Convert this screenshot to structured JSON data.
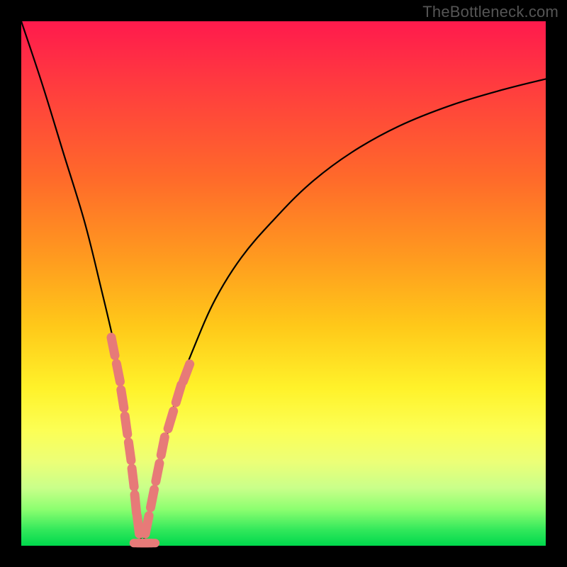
{
  "watermark": "TheBottleneck.com",
  "chart_data": {
    "type": "line",
    "title": "",
    "xlabel": "",
    "ylabel": "",
    "xlim": [
      0,
      100
    ],
    "ylim": [
      0,
      100
    ],
    "background_gradient": {
      "top_color": "#ff1a4d",
      "bottom_color": "#00d84c",
      "meaning": "red = high bottleneck %, green = 0% bottleneck"
    },
    "series": [
      {
        "name": "bottleneck-curve",
        "description": "V-shaped bottleneck percentage curve; minimum near x≈23 at y≈0",
        "x": [
          0,
          4,
          8,
          12,
          15,
          18,
          20,
          22,
          23,
          24,
          26,
          28,
          30,
          33,
          37,
          42,
          48,
          55,
          63,
          72,
          82,
          92,
          100
        ],
        "values": [
          100,
          88,
          75,
          62,
          50,
          37,
          25,
          10,
          0,
          5,
          13,
          22,
          30,
          38,
          47,
          55,
          62,
          69,
          75,
          80,
          84,
          87,
          89
        ]
      },
      {
        "name": "marker-cluster-left",
        "description": "salmon capsule markers along left arm of V",
        "x": [
          17.5,
          18.5,
          19.3,
          20.0,
          20.7,
          21.3,
          21.8,
          22.3
        ],
        "values": [
          38,
          33,
          28,
          23,
          18,
          13,
          8,
          4
        ]
      },
      {
        "name": "marker-cluster-right",
        "description": "salmon capsule markers along right arm of V",
        "x": [
          24.0,
          25.0,
          26.0,
          27.0,
          28.5,
          30.0,
          31.5
        ],
        "values": [
          4,
          9,
          14,
          19,
          24,
          29,
          33
        ]
      },
      {
        "name": "marker-cluster-bottom",
        "description": "salmon capsules along valley floor",
        "x": [
          22.8,
          23.5,
          24.2
        ],
        "values": [
          0.5,
          0.5,
          0.5
        ]
      }
    ],
    "colors": {
      "curve": "#000000",
      "markers": "#e77a78"
    }
  }
}
